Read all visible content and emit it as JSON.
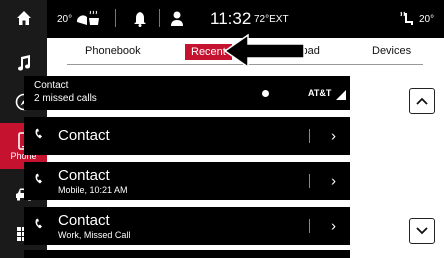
{
  "status": {
    "temp_left": "20°",
    "clock": "11:32",
    "outside_temp": "72°EXT",
    "temp_right": "20°"
  },
  "sidebar": {
    "items": [
      {
        "icon": "home-icon"
      },
      {
        "icon": "music-icon"
      },
      {
        "icon": "compass-icon"
      },
      {
        "icon": "phone-icon",
        "label": "Phone",
        "active": true
      },
      {
        "icon": "car-icon"
      },
      {
        "icon": "apps-grid-icon"
      }
    ]
  },
  "tabs": [
    {
      "label": "Phonebook"
    },
    {
      "label": "Recent",
      "active": true
    },
    {
      "label": "ypad"
    },
    {
      "label": "Devices"
    }
  ],
  "header_row": {
    "title": "Contact",
    "subtitle": "2 missed calls",
    "carrier": "AT&T"
  },
  "calls": [
    {
      "name": "Contact",
      "detail": ""
    },
    {
      "name": "Contact",
      "detail": "Mobile, 10:21 AM"
    },
    {
      "name": "Contact",
      "detail": "Work, Missed Call"
    }
  ],
  "colors": {
    "accent": "#c4122f",
    "background": "#000000"
  }
}
